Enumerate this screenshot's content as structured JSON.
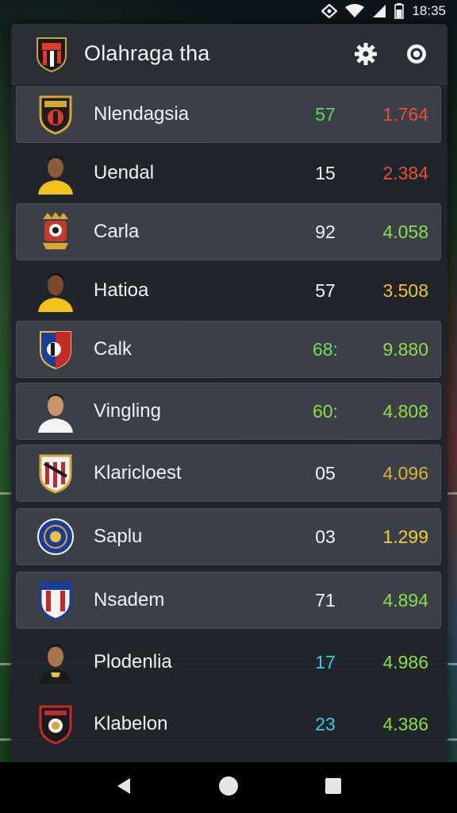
{
  "status_bar": {
    "time": "18:35",
    "icons": [
      "nfc-icon",
      "wifi-icon",
      "signal-icon",
      "battery-icon"
    ]
  },
  "header": {
    "title": "Olahraga tha",
    "logo_icon": "club-crest-icon",
    "actions": [
      {
        "icon": "gear-icon"
      },
      {
        "icon": "target-icon"
      }
    ]
  },
  "colors": {
    "panel": "#20242a",
    "highlight_row": "#3a3f48",
    "green": "#6ee05a",
    "red": "#e8503c",
    "yellow": "#e8c23a",
    "lime": "#9ae04a",
    "cyan": "#3cc8ee",
    "white": "#f4f4f4"
  },
  "rows": [
    {
      "name": "Nlendagsia",
      "num": "57",
      "num_color": "#5fd65a",
      "val": "1.764",
      "val_color": "#e8503c",
      "crest": "club-crest-icon",
      "highlight": true
    },
    {
      "name": "Uendal",
      "num": "15",
      "num_color": "#f4f4f4",
      "val": "2.384",
      "val_color": "#e8503c",
      "crest": "player-avatar-icon",
      "highlight": false
    },
    {
      "name": "Carla",
      "num": "92",
      "num_color": "#f4f4f4",
      "val": "4.058",
      "val_color": "#8fdc44",
      "crest": "royal-crest-icon",
      "highlight": true
    },
    {
      "name": "Hatioa",
      "num": "57",
      "num_color": "#f4f4f4",
      "val": "3.508",
      "val_color": "#e8c23a",
      "crest": "player-avatar-icon",
      "highlight": false
    },
    {
      "name": "Calk",
      "num": "68:",
      "num_color": "#6ee05a",
      "val": "9.880",
      "val_color": "#8fdc44",
      "crest": "shield-crest-icon",
      "highlight": true
    },
    {
      "name": "Vingling",
      "num": "60:",
      "num_color": "#8fdc44",
      "val": "4.808",
      "val_color": "#8fdc44",
      "crest": "player-avatar-icon",
      "highlight": true
    },
    {
      "name": "Klaricloest",
      "num": "05",
      "num_color": "#f4f4f4",
      "val": "4.096",
      "val_color": "#d6b43a",
      "crest": "striped-crest-icon",
      "highlight": true
    },
    {
      "name": "Saplu",
      "num": "03",
      "num_color": "#f4f4f4",
      "val": "1.299",
      "val_color": "#e8d23a",
      "crest": "round-badge-icon",
      "highlight": true
    },
    {
      "name": "Nsadem",
      "num": "71",
      "num_color": "#f4f4f4",
      "val": "4.894",
      "val_color": "#8fdc44",
      "crest": "tricolor-crest-icon",
      "highlight": true
    },
    {
      "name": "Plodenlia",
      "num": "17",
      "num_color": "#3cc8ee",
      "val": "4.986",
      "val_color": "#8fdc44",
      "crest": "player-avatar-icon",
      "highlight": false
    },
    {
      "name": "Klabelon",
      "num": "23",
      "num_color": "#3cc8ee",
      "val": "4.386",
      "val_color": "#8fdc44",
      "crest": "red-crest-icon",
      "highlight": false
    }
  ],
  "nav_bar": {
    "buttons": [
      "back-icon",
      "home-icon",
      "recents-icon"
    ]
  }
}
